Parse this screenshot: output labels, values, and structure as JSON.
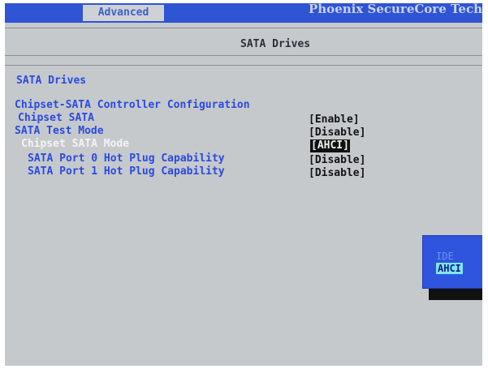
{
  "header": {
    "tab_label": "Advanced",
    "brand_text": "Phoenix SecureCore Tech"
  },
  "page": {
    "title": "SATA Drives"
  },
  "content": {
    "section_title": "SATA Drives",
    "group_title": "Chipset-SATA Controller Configuration",
    "items": [
      {
        "label": "Chipset SATA",
        "value": "[Enable]"
      },
      {
        "label": "SATA Test Mode",
        "value": "[Disable]"
      },
      {
        "label": "Chipset SATA Mode",
        "value": "[AHCI]"
      },
      {
        "label": "SATA Port 0 Hot Plug Capability",
        "value": "[Disable]"
      },
      {
        "label": "SATA Port 1 Hot Plug Capability",
        "value": "[Disable]"
      }
    ]
  },
  "popup": {
    "options": [
      "IDE",
      "AHCI"
    ],
    "selected": "AHCI"
  }
}
